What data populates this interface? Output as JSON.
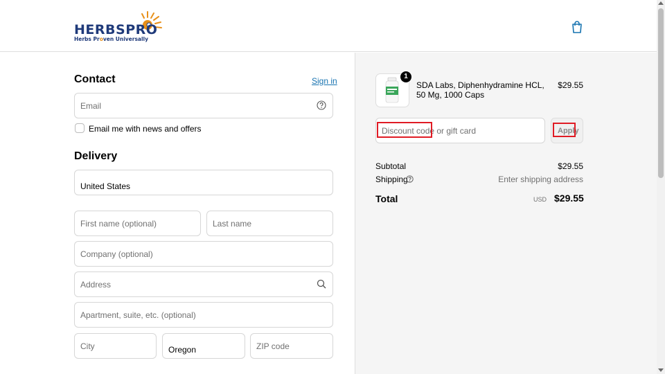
{
  "brand": {
    "logo_word_a": "HERBS",
    "logo_word_b": "PRO",
    "logo_tagline_pre": "Herbs Pr",
    "logo_tagline_o": "o",
    "logo_tagline_post": "ven Universally",
    "accent": "#1f3a7a",
    "sun_color": "#e8901a"
  },
  "header": {
    "cart_icon": "shopping-bag-icon"
  },
  "contact": {
    "title": "Contact",
    "sign_in": "Sign in",
    "email_placeholder": "Email",
    "newsletter_label": "Email me with news and offers"
  },
  "delivery": {
    "title": "Delivery",
    "country_label": "Country/Region",
    "country_value": "United States",
    "first_name_placeholder": "First name (optional)",
    "last_name_placeholder": "Last name",
    "company_placeholder": "Company (optional)",
    "address_placeholder": "Address",
    "apartment_placeholder": "Apartment, suite, etc. (optional)",
    "city_placeholder": "City",
    "state_label": "State",
    "state_value": "Oregon",
    "zip_placeholder": "ZIP code"
  },
  "order": {
    "item": {
      "quantity": "1",
      "name": "SDA Labs, Diphenhydramine HCL, 50 Mg, 1000 Caps",
      "price": "$29.55"
    },
    "discount_placeholder": "Discount code or gift card",
    "apply_label": "Apply",
    "subtotal_label": "Subtotal",
    "subtotal_value": "$29.55",
    "shipping_label": "Shipping",
    "shipping_value": "Enter shipping address",
    "total_label": "Total",
    "total_currency": "USD",
    "total_value": "$29.55"
  },
  "colors": {
    "link": "#1773b0",
    "highlight": "#e01b24",
    "sidebar_bg": "#f5f5f5"
  }
}
